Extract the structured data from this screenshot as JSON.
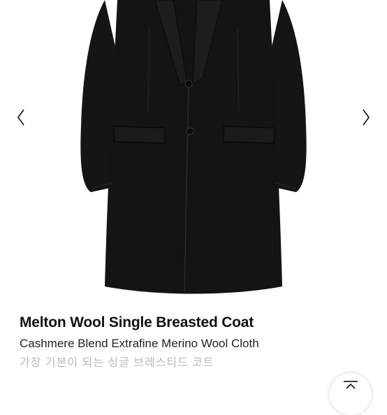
{
  "product": {
    "title": "Melton Wool Single Breasted Coat",
    "subtitle": "Cashmere Blend Extrafine Merino Wool Cloth",
    "description_ko": "가장 기본이 되는 싱글 브레스티드 코트"
  },
  "gallery": {
    "prev_icon": "chevron-left-icon",
    "next_icon": "chevron-right-icon",
    "coat_color": "#141414"
  },
  "controls": {
    "scroll_top_icon": "scroll-to-top-icon"
  }
}
